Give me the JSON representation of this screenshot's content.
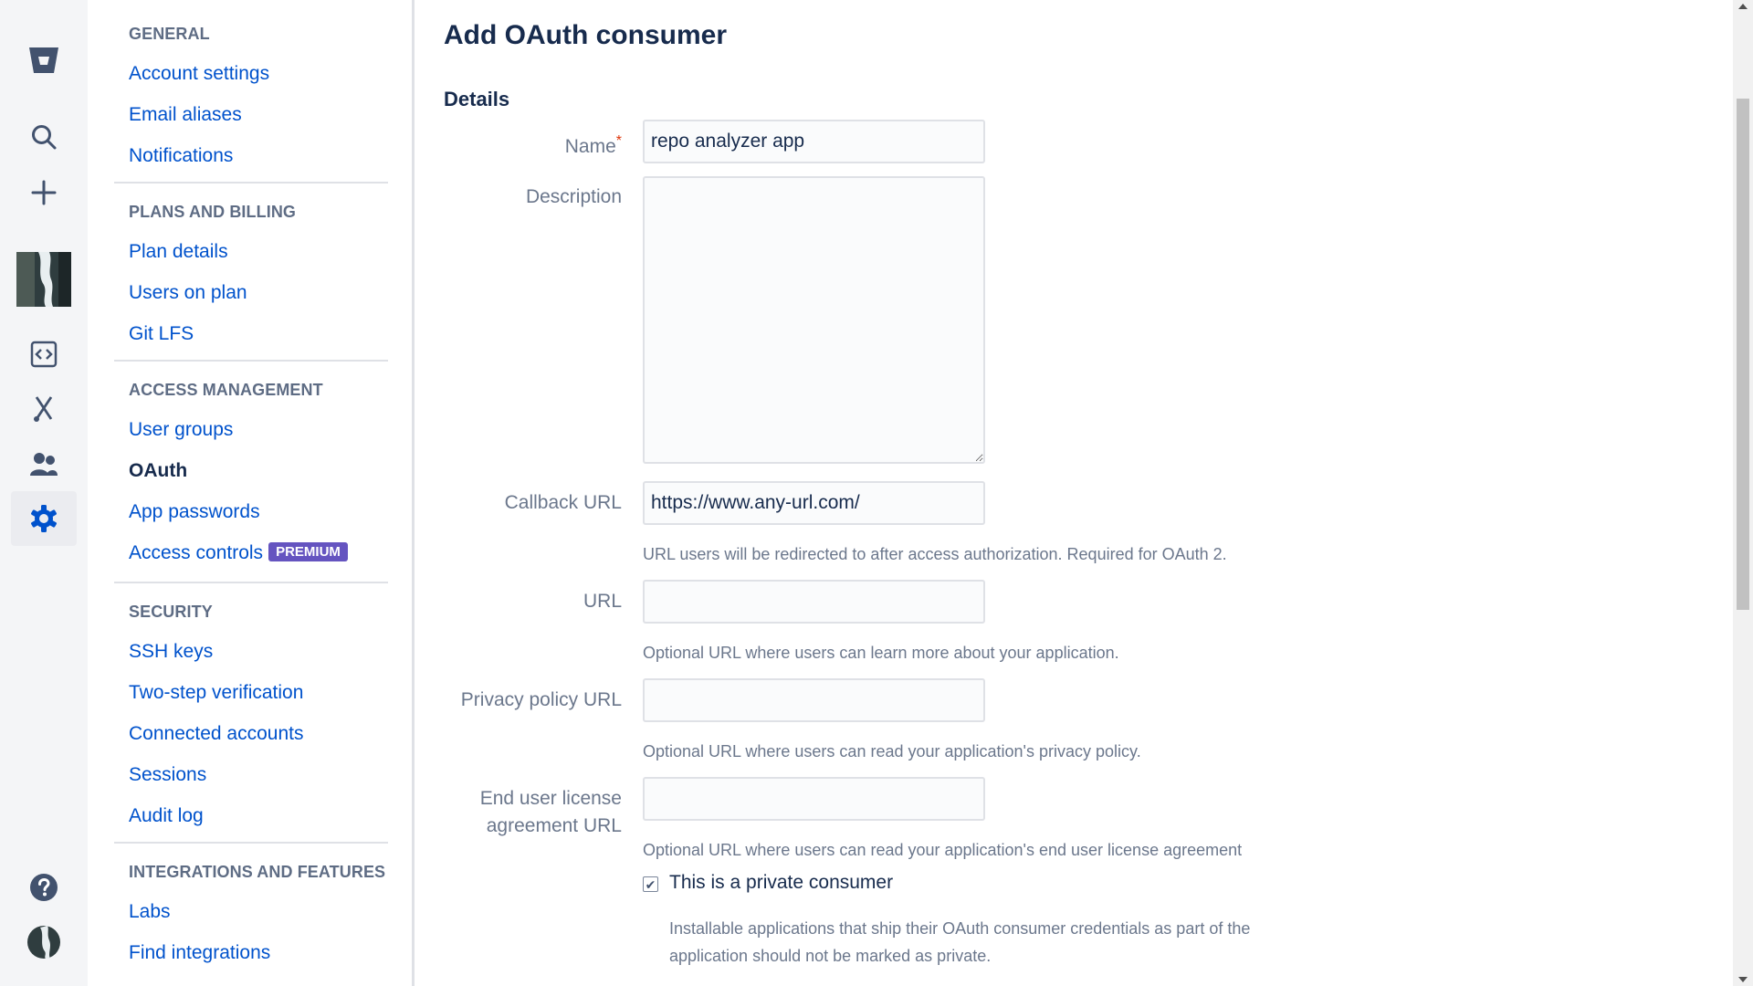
{
  "rail": {
    "items": [
      {
        "icon": "bitbucket-logo-icon"
      },
      {
        "icon": "search-icon"
      },
      {
        "icon": "plus-icon"
      },
      {
        "icon": "workspace-avatar"
      },
      {
        "icon": "code-icon"
      },
      {
        "icon": "tools-icon"
      },
      {
        "icon": "people-icon"
      },
      {
        "icon": "gear-icon",
        "active": true
      },
      {
        "icon": "help-icon"
      },
      {
        "icon": "user-avatar"
      }
    ],
    "accent": "#0052cc"
  },
  "sidebar": {
    "sections": {
      "general": {
        "heading": "GENERAL",
        "items": [
          "Account settings",
          "Email aliases",
          "Notifications"
        ]
      },
      "billing": {
        "heading": "PLANS AND BILLING",
        "items": [
          "Plan details",
          "Users on plan",
          "Git LFS"
        ]
      },
      "access": {
        "heading": "ACCESS MANAGEMENT",
        "items": [
          "User groups",
          "OAuth",
          "App passwords",
          "Access controls"
        ],
        "current": "OAuth",
        "premium_badge": "PREMIUM"
      },
      "security": {
        "heading": "SECURITY",
        "items": [
          "SSH keys",
          "Two-step verification",
          "Connected accounts",
          "Sessions",
          "Audit log"
        ]
      },
      "integrations": {
        "heading": "INTEGRATIONS AND FEATURES",
        "items": [
          "Labs",
          "Find integrations"
        ]
      }
    }
  },
  "main": {
    "title": "Add OAuth consumer",
    "section": "Details",
    "fields": {
      "name": {
        "label": "Name",
        "required": "*",
        "value": "repo analyzer app"
      },
      "description": {
        "label": "Description",
        "value": ""
      },
      "callback_url": {
        "label": "Callback URL",
        "value": "https://www.any-url.com/",
        "help": "URL users will be redirected to after access authorization. Required for OAuth 2."
      },
      "url": {
        "label": "URL",
        "value": "",
        "help": "Optional URL where users can learn more about your application."
      },
      "privacy_url": {
        "label": "Privacy policy URL",
        "value": "",
        "help": "Optional URL where users can read your application's privacy policy."
      },
      "eula_url": {
        "label_line1": "End user license",
        "label_line2": "agreement URL",
        "value": "",
        "help": "Optional URL where users can read your application's end user license agreement"
      }
    },
    "private_consumer": {
      "label": "This is a private consumer",
      "checked": true,
      "help": "Installable applications that ship their OAuth consumer credentials as part of the application should not be marked as private."
    }
  },
  "colors": {
    "link": "#0052cc",
    "text": "#172b4d",
    "muted": "#6b778c",
    "premium": "#6554c0",
    "required": "#de350b"
  }
}
